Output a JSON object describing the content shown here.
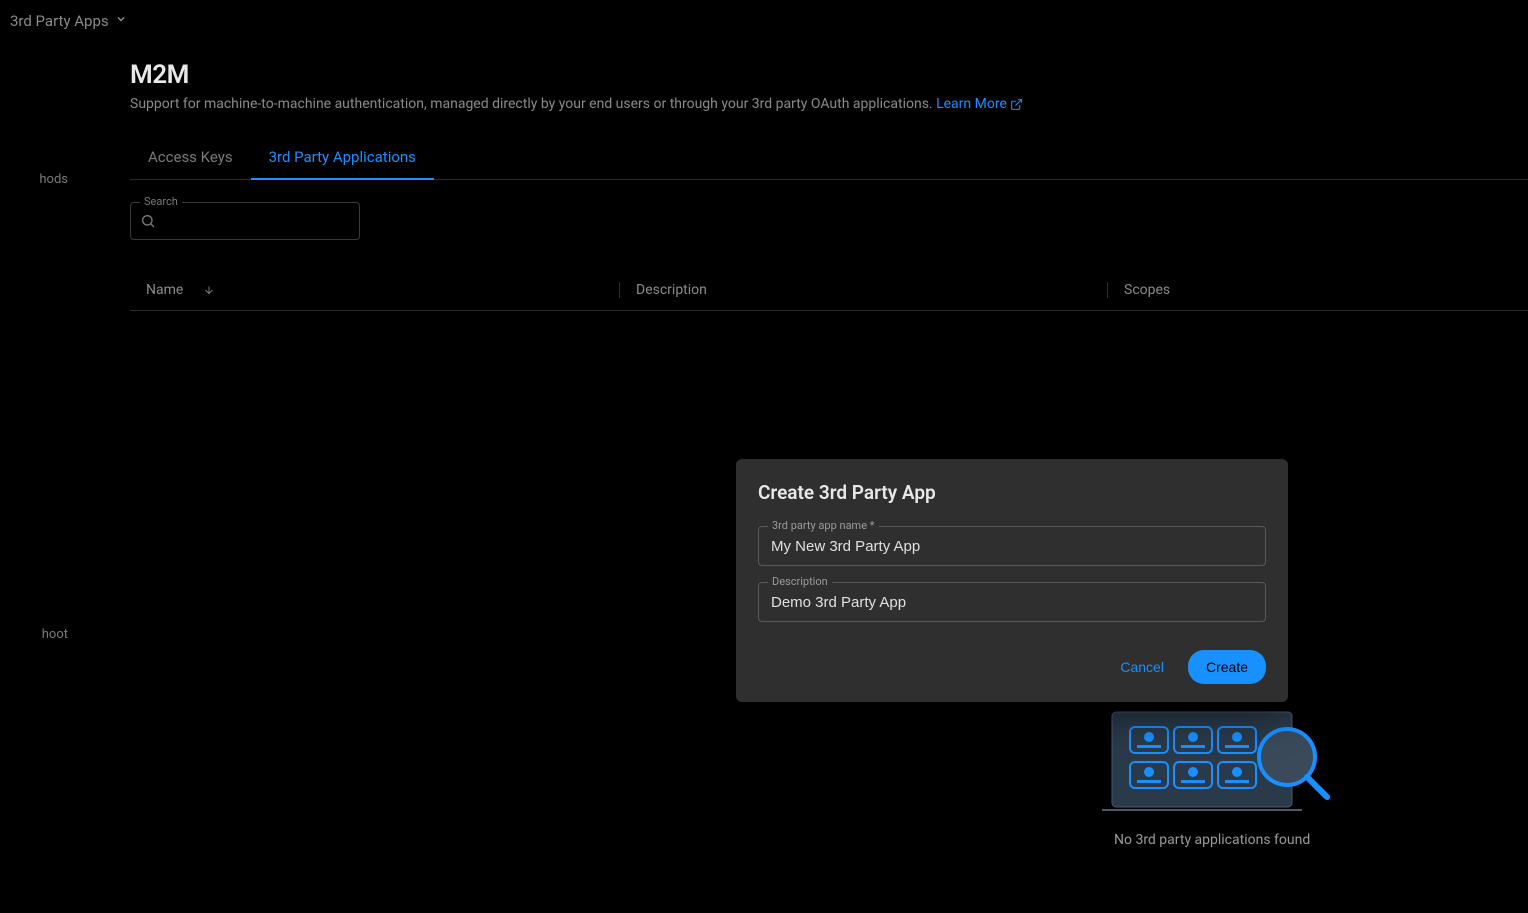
{
  "breadcrumb": {
    "label": "3rd Party Apps"
  },
  "sidebar": {
    "item1": "hods",
    "item2": "hoot"
  },
  "header": {
    "title": "M2M",
    "description": "Support for machine-to-machine authentication, managed directly by your end users or through your 3rd party OAuth applications.",
    "learn_more": "Learn More"
  },
  "tabs": {
    "access_keys": "Access Keys",
    "third_party": "3rd Party Applications"
  },
  "search": {
    "label": "Search"
  },
  "table": {
    "columns": {
      "name": "Name",
      "description": "Description",
      "scopes": "Scopes"
    }
  },
  "empty": {
    "message": "No 3rd party applications found"
  },
  "modal": {
    "title": "Create 3rd Party App",
    "name_label": "3rd party app name *",
    "name_value": "My New 3rd Party App",
    "desc_label": "Description",
    "desc_value": "Demo 3rd Party App",
    "cancel": "Cancel",
    "create": "Create"
  }
}
